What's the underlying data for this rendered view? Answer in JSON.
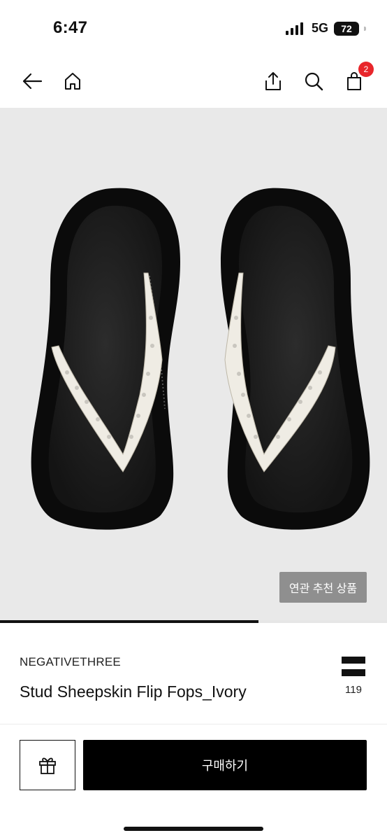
{
  "status": {
    "time": "6:47",
    "network": "5G",
    "battery": "72"
  },
  "nav": {
    "cart_count": "2"
  },
  "gallery": {
    "related_label": "연관 추천 상품",
    "progress": 0.667
  },
  "product": {
    "brand": "NEGATIVETHREE",
    "name": "Stud Sheepskin Flip Fops_Ivory",
    "like_count": "119"
  },
  "actions": {
    "buy_label": "구매하기"
  },
  "icons": {
    "back": "arrow-left-icon",
    "home": "home-icon",
    "share": "share-icon",
    "search": "search-icon",
    "cart": "shopping-bag-icon",
    "like": "like-icon",
    "gift": "gift-icon"
  },
  "colors": {
    "badge": "#e8262b",
    "buy_button": "#000000",
    "gallery_bg": "#e9e9e9",
    "related_button": "#8f8f8f"
  }
}
